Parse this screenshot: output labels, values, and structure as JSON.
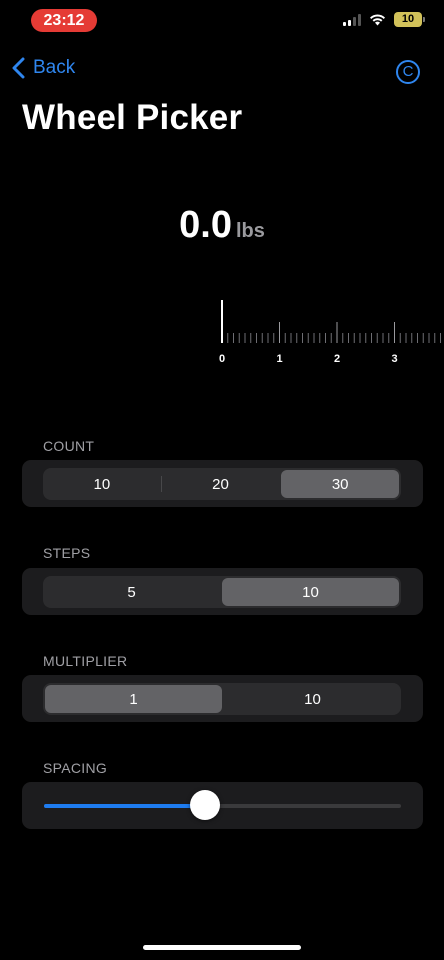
{
  "status_bar": {
    "time": "23:12",
    "battery": "10"
  },
  "nav": {
    "back_label": "Back",
    "copyright_label": "C"
  },
  "title": "Wheel Picker",
  "readout": {
    "value": "0.0",
    "unit": "lbs"
  },
  "ruler": {
    "labels": [
      "0",
      "1",
      "2",
      "3"
    ]
  },
  "count": {
    "label": "COUNT",
    "options": [
      "10",
      "20",
      "30"
    ],
    "selected_index": 2
  },
  "steps": {
    "label": "STEPS",
    "options": [
      "5",
      "10"
    ],
    "selected_index": 1
  },
  "multiplier": {
    "label": "MULTIPLIER",
    "options": [
      "1",
      "10"
    ],
    "selected_index": 0
  },
  "spacing": {
    "label": "SPACING",
    "value_fraction": 0.45
  },
  "colors": {
    "accent": "#2f86ef",
    "slider_fill": "#1e7cf0",
    "time_pill": "#e53b35"
  }
}
